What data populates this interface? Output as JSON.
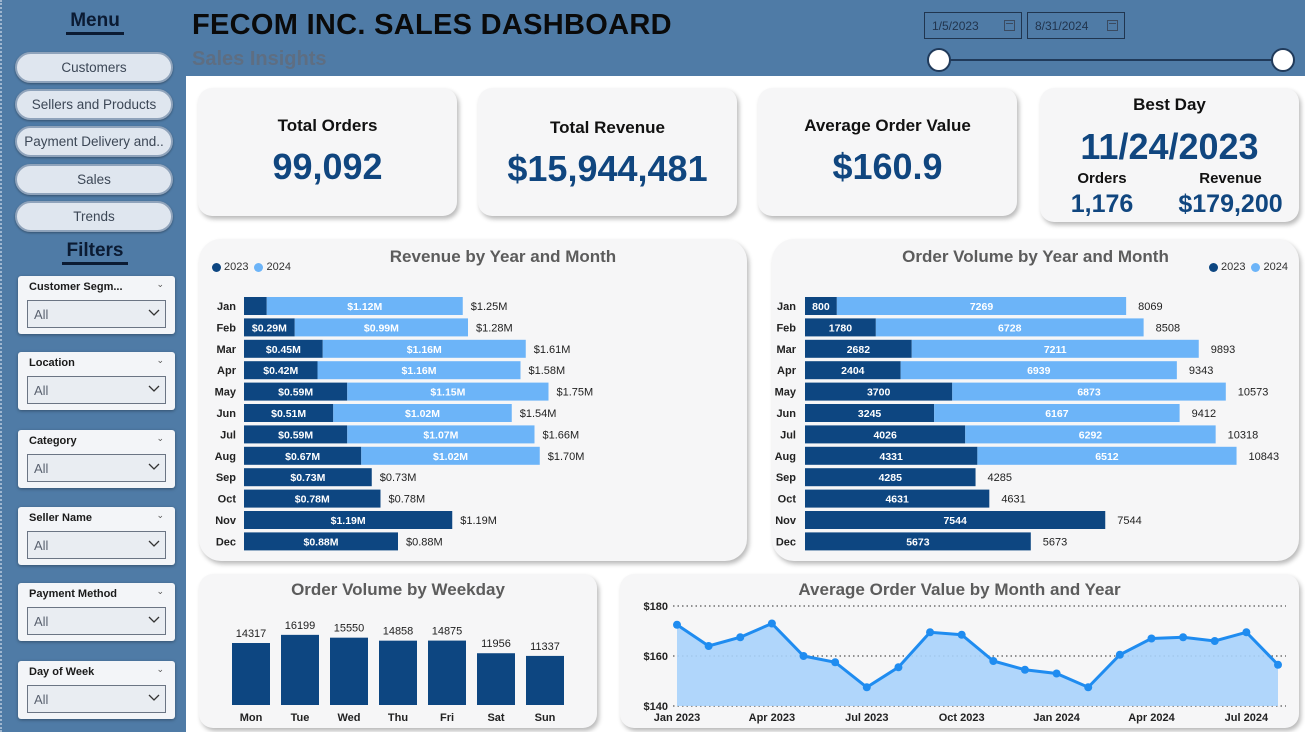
{
  "menu": {
    "heading": "Menu",
    "items": [
      "Customers",
      "Sellers and Products",
      "Payment Delivery and..",
      "Sales",
      "Trends"
    ]
  },
  "filters": {
    "heading": "Filters",
    "items": [
      {
        "label": "Customer Segm...",
        "value": "All"
      },
      {
        "label": "Location",
        "value": "All"
      },
      {
        "label": "Category",
        "value": "All"
      },
      {
        "label": "Seller Name",
        "value": "All"
      },
      {
        "label": "Payment Method",
        "value": "All"
      },
      {
        "label": "Day of Week",
        "value": "All"
      }
    ]
  },
  "header": {
    "title": "FECOM INC. SALES DASHBOARD",
    "subtitle": "Sales Insights",
    "date_start": "1/5/2023",
    "date_end": "8/31/2024"
  },
  "kpis": {
    "total_orders": {
      "label": "Total Orders",
      "value": "99,092"
    },
    "total_revenue": {
      "label": "Total Revenue",
      "value": "$15,944,481"
    },
    "avg_order_value": {
      "label": "Average Order Value",
      "value": "$160.9"
    },
    "best_day": {
      "label": "Best Day",
      "date": "11/24/2023",
      "orders_label": "Orders",
      "orders_value": "1,176",
      "revenue_label": "Revenue",
      "revenue_value": "$179,200"
    }
  },
  "colors": {
    "dark_blue": "#0d4681",
    "light_blue": "#6cb4f8",
    "sidebar": "#4f7ba6",
    "kpi_text": "#10467f"
  },
  "chart_data": [
    {
      "type": "bar",
      "orientation": "horizontal-stacked",
      "title": "Revenue by Year and Month",
      "legend": [
        "2023",
        "2024"
      ],
      "legend_position": "top-left",
      "categories": [
        "Jan",
        "Feb",
        "Mar",
        "Apr",
        "May",
        "Jun",
        "Jul",
        "Aug",
        "Sep",
        "Oct",
        "Nov",
        "Dec"
      ],
      "series": [
        {
          "name": "2023",
          "values": [
            0.13,
            0.29,
            0.45,
            0.42,
            0.59,
            0.51,
            0.59,
            0.67,
            0.73,
            0.78,
            1.19,
            0.88
          ],
          "labels": [
            "",
            "$0.29M",
            "$0.45M",
            "$0.42M",
            "$0.59M",
            "$0.51M",
            "$0.59M",
            "$0.67M",
            "$0.73M",
            "$0.78M",
            "$1.19M",
            "$0.88M"
          ]
        },
        {
          "name": "2024",
          "values": [
            1.12,
            0.99,
            1.16,
            1.16,
            1.15,
            1.02,
            1.07,
            1.02,
            0,
            0,
            0,
            0
          ],
          "labels": [
            "$1.12M",
            "$0.99M",
            "$1.16M",
            "$1.16M",
            "$1.15M",
            "$1.02M",
            "$1.07M",
            "$1.02M",
            "",
            "",
            "",
            ""
          ]
        }
      ],
      "totals": [
        "$1.25M",
        "$1.28M",
        "$1.61M",
        "$1.58M",
        "$1.75M",
        "$1.54M",
        "$1.66M",
        "$1.70M",
        "$0.73M",
        "$0.78M",
        "$1.19M",
        "$0.88M"
      ]
    },
    {
      "type": "bar",
      "orientation": "horizontal-stacked",
      "title": "Order Volume by Year and Month",
      "legend": [
        "2023",
        "2024"
      ],
      "legend_position": "top-right",
      "categories": [
        "Jan",
        "Feb",
        "Mar",
        "Apr",
        "May",
        "Jun",
        "Jul",
        "Aug",
        "Sep",
        "Oct",
        "Nov",
        "Dec"
      ],
      "series": [
        {
          "name": "2023",
          "values": [
            800,
            1780,
            2682,
            2404,
            3700,
            3245,
            4026,
            4331,
            4285,
            4631,
            7544,
            5673
          ]
        },
        {
          "name": "2024",
          "values": [
            7269,
            6728,
            7211,
            6939,
            6873,
            6167,
            6292,
            6512,
            0,
            0,
            0,
            0
          ]
        }
      ],
      "totals": [
        "8069",
        "8508",
        "9893",
        "9343",
        "10573",
        "9412",
        "10318",
        "10843",
        "4285",
        "4631",
        "7544",
        "5673"
      ]
    },
    {
      "type": "bar",
      "title": "Order Volume by Weekday",
      "categories": [
        "Mon",
        "Tue",
        "Wed",
        "Thu",
        "Fri",
        "Sat",
        "Sun"
      ],
      "values": [
        14317,
        16199,
        15550,
        14858,
        14875,
        11956,
        11337
      ]
    },
    {
      "type": "area",
      "title": "Average Order Value by Month and Year",
      "x": [
        "2023-01",
        "2023-02",
        "2023-03",
        "2023-04",
        "2023-05",
        "2023-06",
        "2023-07",
        "2023-08",
        "2023-09",
        "2023-10",
        "2023-11",
        "2023-12",
        "2024-01",
        "2024-02",
        "2024-03",
        "2024-04",
        "2024-05",
        "2024-06",
        "2024-07",
        "2024-08"
      ],
      "values": [
        172.5,
        164,
        167.5,
        173,
        160,
        157.5,
        147.5,
        155.5,
        169.5,
        168.5,
        158,
        154.5,
        153,
        147.5,
        160.5,
        167,
        167.5,
        166,
        169.5,
        156.5
      ],
      "x_tick_labels": [
        "Jan 2023",
        "Apr 2023",
        "Jul 2023",
        "Oct 2023",
        "Jan 2024",
        "Apr 2024",
        "Jul 2024"
      ],
      "y_tick_labels": [
        "$180",
        "$160",
        "$140"
      ],
      "ylim": [
        140,
        180
      ],
      "grid": "dotted"
    }
  ]
}
